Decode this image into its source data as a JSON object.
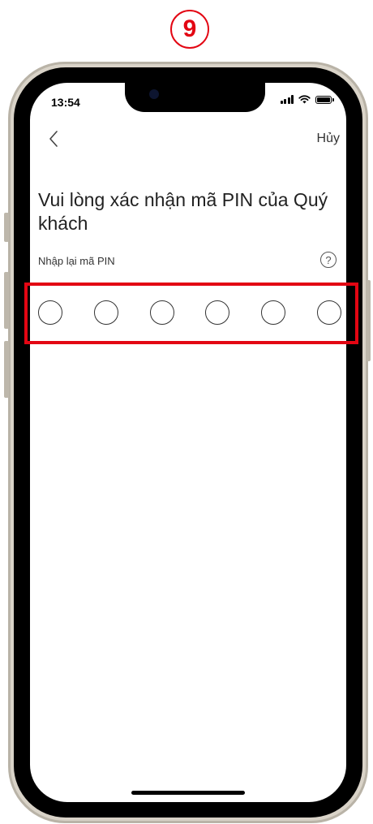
{
  "annotation": {
    "step_number": "9",
    "accent_color": "#e30613"
  },
  "status_bar": {
    "time": "13:54"
  },
  "nav": {
    "back_icon": "chevron-left-icon",
    "cancel_label": "Hủy"
  },
  "main": {
    "title": "Vui lòng xác nhận mã PIN của Quý khách",
    "pin_label": "Nhập lại mã PIN",
    "help_symbol": "?",
    "pin_length": 6,
    "pin_entered": 0
  }
}
